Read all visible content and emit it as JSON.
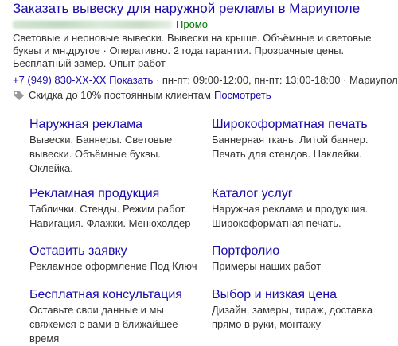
{
  "ad": {
    "title": "Заказать вывеску для наружной рекламы в Мариуполе",
    "promo_label": "Промо",
    "description": "Световые и неоновые вывески. Вывески на крыше. Объёмные и световые буквы и мн.другое · Оперативно. 2 года гарантии. Прозрачные цены. Бесплатный замер. Опыт работ",
    "phone": "+7 (949) 830-XX-XX",
    "show_phone": "Показать",
    "hours_sep": " · ",
    "hours": "пн-пт: 09:00-12:00, пн-пт: 13:00-18:00",
    "city_sep": " · ",
    "city": "Мариуполь",
    "discount_text": "Скидка до 10% постоянным клиентам",
    "discount_link": "Посмотреть",
    "icons": {
      "tag": "tag-icon"
    }
  },
  "sitelinks": [
    {
      "title": "Наружная реклама",
      "desc": "Вывески. Баннеры. Световые вывески. Объёмные буквы. Оклейка."
    },
    {
      "title": "Широкоформатная печать",
      "desc": "Баннерная ткань. Литой баннер. Печать для стендов. Наклейки."
    },
    {
      "title": "Рекламная продукция",
      "desc": "Таблички. Стенды. Режим работ. Навигация. Флажки. Менюхолдер"
    },
    {
      "title": "Каталог услуг",
      "desc": "Наружная реклама и продукция. Широкоформатная печать."
    },
    {
      "title": "Оставить заявку",
      "desc": "Рекламное оформление Под Ключ"
    },
    {
      "title": "Портфолио",
      "desc": "Примеры наших работ"
    },
    {
      "title": "Бесплатная консультация",
      "desc": "Оставьте свои данные и мы свяжемся с вами в ближайшее время"
    },
    {
      "title": "Выбор и низкая цена",
      "desc": "Дизайн, замеры, тираж, доставка прямо в руки, монтажу"
    }
  ],
  "colors": {
    "link": "#1a0dab",
    "promo": "#007700",
    "text": "#333333"
  }
}
